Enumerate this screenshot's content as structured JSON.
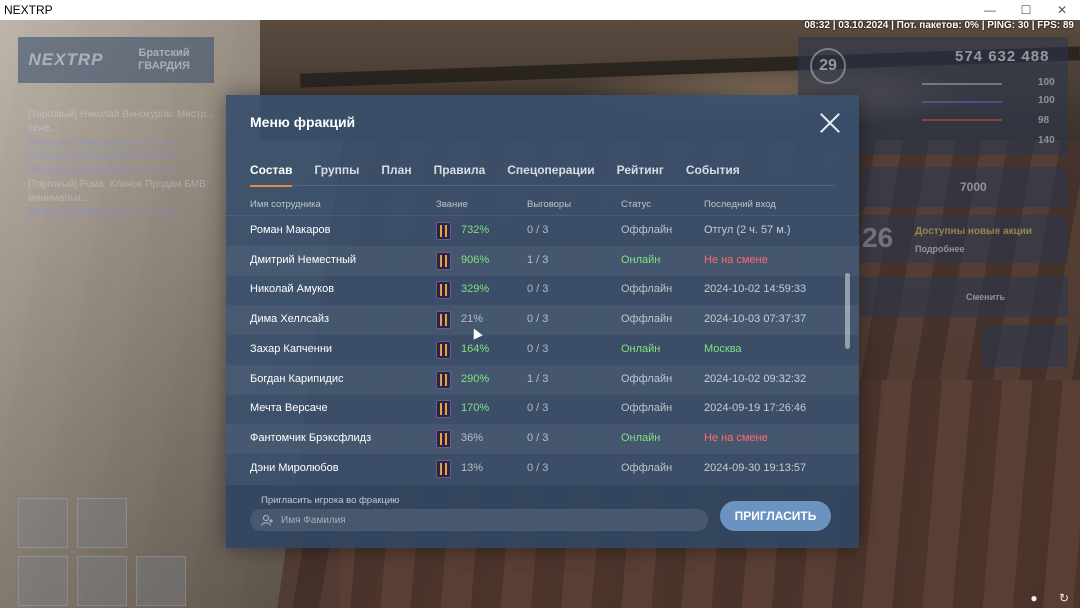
{
  "window": {
    "title": "NEXTRP",
    "minimize": "—",
    "maximize": "☐",
    "close": "✕"
  },
  "status_line": "08:32 | 03.10.2024 | Пот. пакетов: 0% | PING: 30 | FPS: 89",
  "hud": {
    "logo": "NEXTRP",
    "server": "Братский\nГВАРДИЯ",
    "level": "29",
    "money": "574 632 488",
    "stats": [
      "100",
      "100",
      "98",
      "140"
    ],
    "reward": "7000",
    "promo": "Доступны новые акции",
    "promo_sub": "Подробнее",
    "timer": "26",
    "switch_label": "Сменить"
  },
  "modal": {
    "title": "Меню фракций",
    "tabs": [
      {
        "label": "Состав",
        "active": true
      },
      {
        "label": "Группы"
      },
      {
        "label": "План"
      },
      {
        "label": "Правила"
      },
      {
        "label": "Спецоперации"
      },
      {
        "label": "Рейтинг"
      },
      {
        "label": "События"
      }
    ],
    "columns": {
      "name": "Имя сотрудника",
      "rank": "Звание",
      "warnings": "Выговоры",
      "status": "Статус",
      "last_login": "Последний вход"
    },
    "members": [
      {
        "name": "Роман Макаров",
        "rank_pct": "732%",
        "warnings": "0 / 3",
        "status": "Оффлайн",
        "last": "Отгул (2 ч. 57 м.)",
        "pct_color": "green",
        "status_type": "off",
        "last_type": "gray"
      },
      {
        "name": "Дмитрий Неместный",
        "rank_pct": "906%",
        "warnings": "1 / 3",
        "status": "Онлайн",
        "last": "Не на смене",
        "pct_color": "green",
        "status_type": "on",
        "last_type": "red"
      },
      {
        "name": "Николай Амуков",
        "rank_pct": "329%",
        "warnings": "0 / 3",
        "status": "Оффлайн",
        "last": "2024-10-02 14:59:33",
        "pct_color": "green",
        "status_type": "off",
        "last_type": "gray"
      },
      {
        "name": "Дима Хеллсайз",
        "rank_pct": "21%",
        "warnings": "0 / 3",
        "status": "Оффлайн",
        "last": "2024-10-03 07:37:37",
        "pct_color": "gray",
        "status_type": "off",
        "last_type": "gray"
      },
      {
        "name": "Захар Капченни",
        "rank_pct": "164%",
        "warnings": "0 / 3",
        "status": "Онлайн",
        "last": "Москва",
        "pct_color": "green",
        "status_type": "on",
        "last_type": "green"
      },
      {
        "name": "Богдан Карипидис",
        "rank_pct": "290%",
        "warnings": "1 / 3",
        "status": "Оффлайн",
        "last": "2024-10-02 09:32:32",
        "pct_color": "green",
        "status_type": "off",
        "last_type": "gray"
      },
      {
        "name": "Мечта Версаче",
        "rank_pct": "170%",
        "warnings": "0 / 3",
        "status": "Оффлайн",
        "last": "2024-09-19 17:26:46",
        "pct_color": "green",
        "status_type": "off",
        "last_type": "gray"
      },
      {
        "name": "Фантомчик Брэксфлидз",
        "rank_pct": "36%",
        "warnings": "0 / 3",
        "status": "Онлайн",
        "last": "Не на смене",
        "pct_color": "gray",
        "status_type": "on",
        "last_type": "red"
      },
      {
        "name": "Дэни Миролюбов",
        "rank_pct": "13%",
        "warnings": "0 / 3",
        "status": "Оффлайн",
        "last": "2024-09-30 19:13:57",
        "pct_color": "gray",
        "status_type": "off",
        "last_type": "gray"
      }
    ],
    "invite": {
      "label": "Пригласить игрока во фракцию",
      "placeholder": "Имя Фамилия",
      "button": "ПРИГЛАСИТЬ"
    }
  },
  "colors": {
    "accent_tab": "#e8893c",
    "online": "#7fe27f",
    "offduty": "#ff6b6b",
    "modal_bg": "#3a506c",
    "button": "#6a93c0"
  }
}
